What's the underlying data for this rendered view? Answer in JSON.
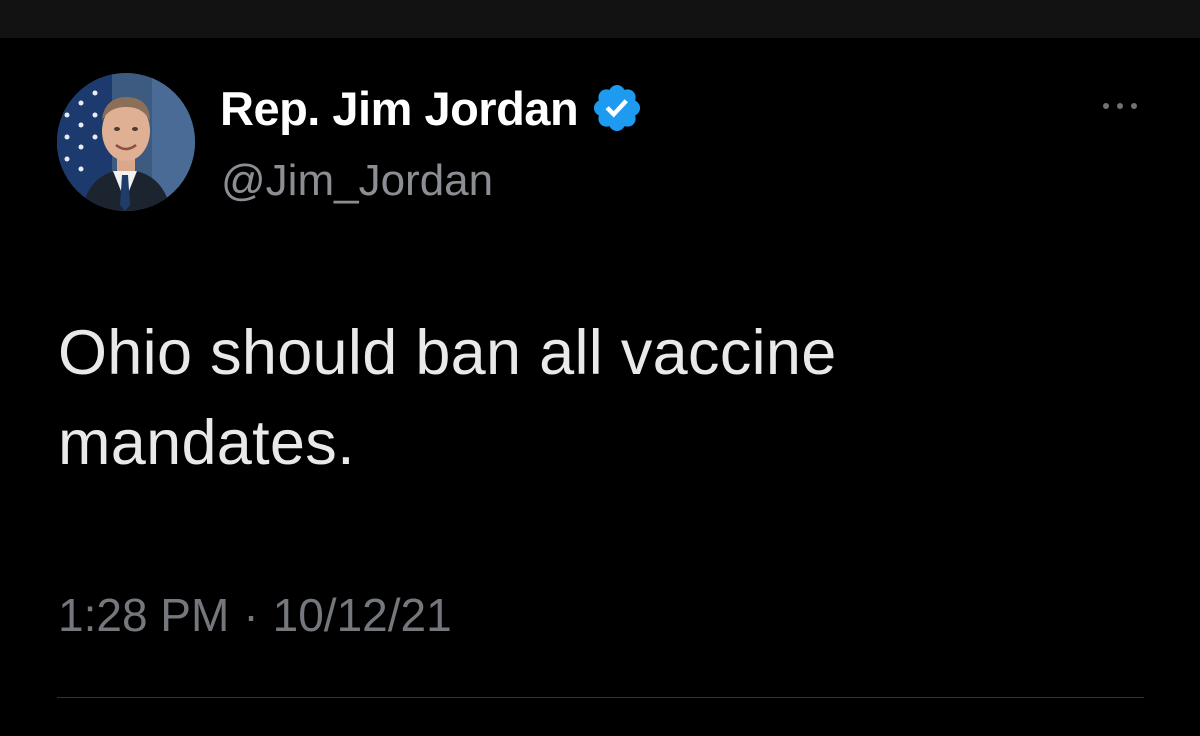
{
  "tweet": {
    "display_name": "Rep. Jim Jordan",
    "handle": "@Jim_Jordan",
    "text": "Ohio should ban all vaccine mandates.",
    "time": "1:28 PM",
    "separator": "·",
    "date": "10/12/21"
  },
  "icons": {
    "verified": "verified-badge-icon",
    "more": "more-options-icon"
  },
  "colors": {
    "background": "#000000",
    "top_bar": "#121212",
    "verified_blue": "#1d9bf0",
    "secondary_text": "#74787c"
  }
}
